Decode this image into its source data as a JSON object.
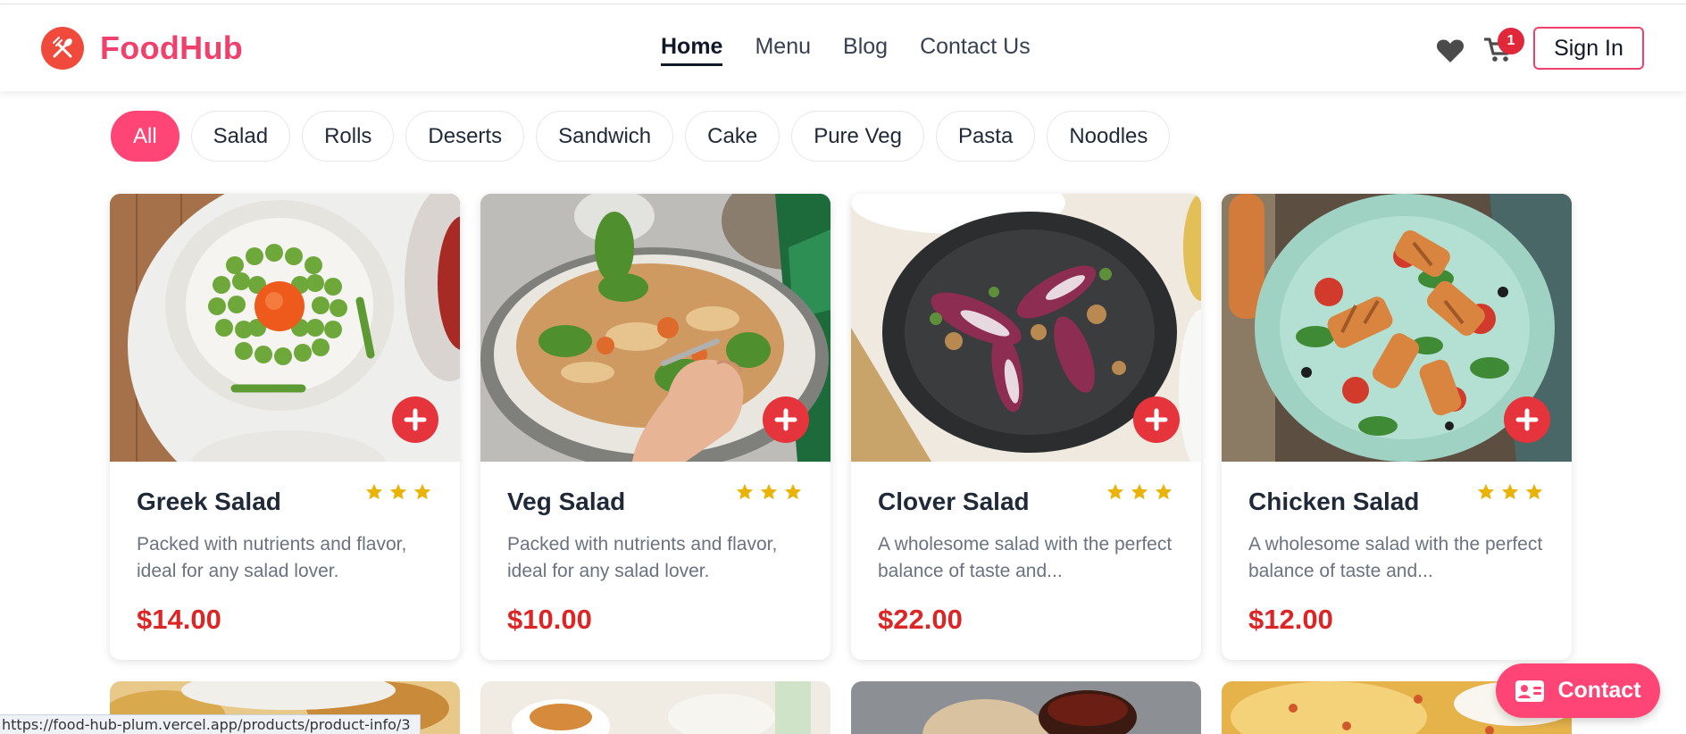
{
  "brand": {
    "name": "FoodHub",
    "logo_icon": "fork-knife-icon",
    "color": "#f0416c"
  },
  "nav": {
    "links": [
      {
        "label": "Home",
        "active": true
      },
      {
        "label": "Menu",
        "active": false
      },
      {
        "label": "Blog",
        "active": false
      },
      {
        "label": "Contact Us",
        "active": false
      }
    ],
    "cart_count": "1",
    "signin_label": "Sign In"
  },
  "categories": [
    {
      "label": "All",
      "active": true
    },
    {
      "label": "Salad",
      "active": false
    },
    {
      "label": "Rolls",
      "active": false
    },
    {
      "label": "Deserts",
      "active": false
    },
    {
      "label": "Sandwich",
      "active": false
    },
    {
      "label": "Cake",
      "active": false
    },
    {
      "label": "Pure Veg",
      "active": false
    },
    {
      "label": "Pasta",
      "active": false
    },
    {
      "label": "Noodles",
      "active": false
    }
  ],
  "products": [
    {
      "name": "Greek Salad",
      "rating": 3,
      "description": "Packed with nutrients and flavor, ideal for any salad lover.",
      "price": "$14.00"
    },
    {
      "name": "Veg Salad",
      "rating": 3,
      "description": "Packed with nutrients and flavor, ideal for any salad lover.",
      "price": "$10.00"
    },
    {
      "name": "Clover Salad",
      "rating": 3,
      "description": "A wholesome salad with the perfect balance of taste and...",
      "price": "$22.00"
    },
    {
      "name": "Chicken Salad",
      "rating": 3,
      "description": "A wholesome salad with the perfect balance of taste and...",
      "price": "$12.00"
    }
  ],
  "contact_button": {
    "label": "Contact"
  },
  "status_bar": {
    "url": "https://food-hub-plum.vercel.app/products/product-info/3"
  },
  "colors": {
    "accent": "#ff4476",
    "price": "#dc2626",
    "add_button": "#e5343c",
    "star": "#eab308"
  }
}
